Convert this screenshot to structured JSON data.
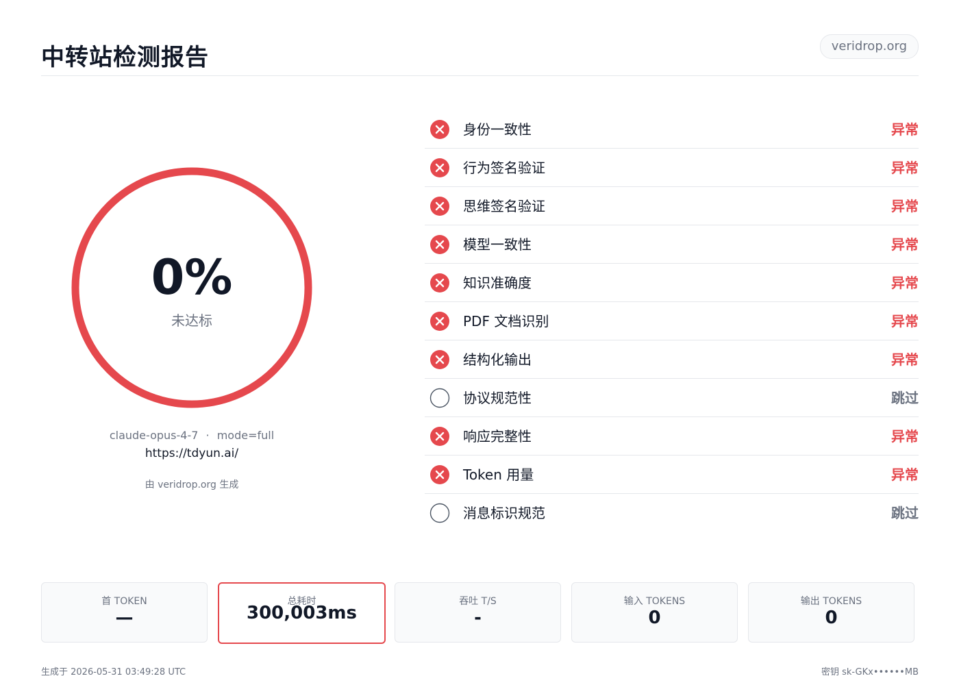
{
  "header": {
    "title": "中转站检测报告",
    "brand": "veridrop.org"
  },
  "score": {
    "value": "0%",
    "percent": 0,
    "label": "未达标",
    "ring_color": "#e5484d"
  },
  "meta": {
    "model": "claude-opus-4-7",
    "separator": "·",
    "mode": "mode=full",
    "url": "https://tdyun.ai/",
    "generated_by": "由 veridrop.org 生成"
  },
  "colors": {
    "fail": "#e5484d",
    "skip": "#6b7280"
  },
  "checks": [
    {
      "name": "身份一致性",
      "status": "异常",
      "state": "fail",
      "icon": "x-circle-icon"
    },
    {
      "name": "行为签名验证",
      "status": "异常",
      "state": "fail",
      "icon": "x-circle-icon"
    },
    {
      "name": "思维签名验证",
      "status": "异常",
      "state": "fail",
      "icon": "x-circle-icon"
    },
    {
      "name": "模型一致性",
      "status": "异常",
      "state": "fail",
      "icon": "x-circle-icon"
    },
    {
      "name": "知识准确度",
      "status": "异常",
      "state": "fail",
      "icon": "x-circle-icon"
    },
    {
      "name": "PDF 文档识别",
      "status": "异常",
      "state": "fail",
      "icon": "x-circle-icon"
    },
    {
      "name": "结构化输出",
      "status": "异常",
      "state": "fail",
      "icon": "x-circle-icon"
    },
    {
      "name": "协议规范性",
      "status": "跳过",
      "state": "skip",
      "icon": "empty-circle-icon"
    },
    {
      "name": "响应完整性",
      "status": "异常",
      "state": "fail",
      "icon": "x-circle-icon"
    },
    {
      "name": "Token 用量",
      "status": "异常",
      "state": "fail",
      "icon": "x-circle-icon"
    },
    {
      "name": "消息标识规范",
      "status": "跳过",
      "state": "skip",
      "icon": "empty-circle-icon"
    }
  ],
  "metrics": [
    {
      "label": "首 TOKEN",
      "value": "—",
      "highlight": false
    },
    {
      "label": "总耗时",
      "value": "300,003ms",
      "highlight": true
    },
    {
      "label": "吞吐 T/S",
      "value": "-",
      "highlight": false
    },
    {
      "label": "输入 TOKENS",
      "value": "0",
      "highlight": false
    },
    {
      "label": "输出 TOKENS",
      "value": "0",
      "highlight": false
    }
  ],
  "footer": {
    "generated_at": "生成于 2026-05-31 03:49:28 UTC",
    "key": "密钥 sk-GKx••••••MB"
  }
}
